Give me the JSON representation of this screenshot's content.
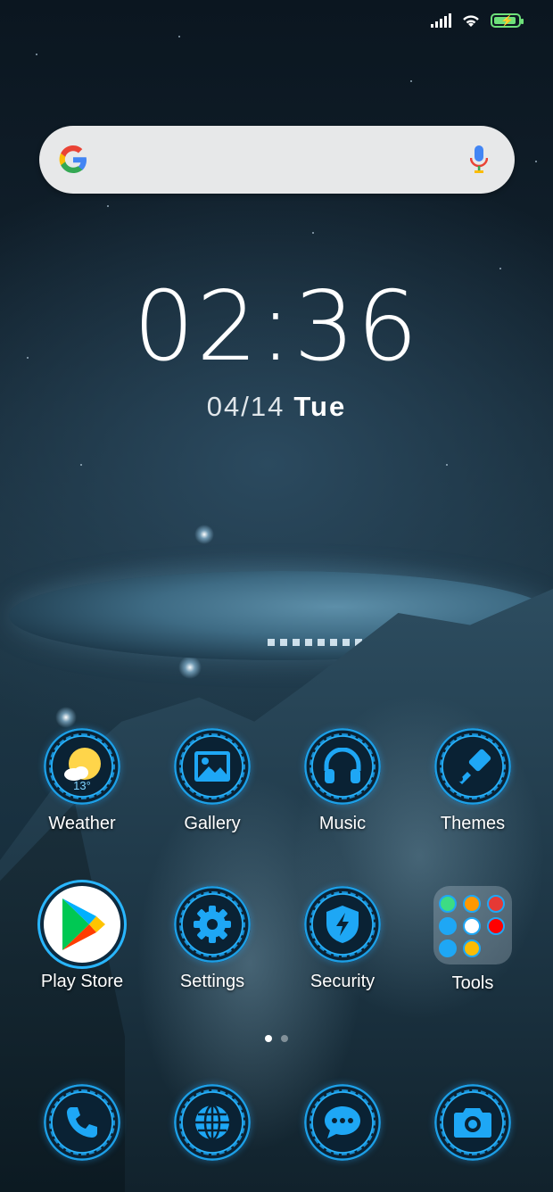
{
  "status_bar": {
    "signal": "signal-icon",
    "wifi": "wifi-icon",
    "battery": "battery-charging-icon",
    "battery_color": "#6ee07a"
  },
  "search": {
    "logo": "google-logo",
    "mic": "mic-icon"
  },
  "clock": {
    "time": "02:36",
    "date": "04/14",
    "day": "Tue"
  },
  "apps": [
    {
      "label": "Weather",
      "icon": "weather-icon",
      "temp": "13°"
    },
    {
      "label": "Gallery",
      "icon": "gallery-icon"
    },
    {
      "label": "Music",
      "icon": "headphones-icon"
    },
    {
      "label": "Themes",
      "icon": "brush-icon"
    },
    {
      "label": "Play Store",
      "icon": "play-store-icon"
    },
    {
      "label": "Settings",
      "icon": "gear-icon"
    },
    {
      "label": "Security",
      "icon": "shield-icon"
    },
    {
      "label": "Tools",
      "icon": "folder-icon"
    }
  ],
  "page_indicator": {
    "pages": 2,
    "active": 1
  },
  "dock": [
    {
      "icon": "phone-icon"
    },
    {
      "icon": "browser-icon"
    },
    {
      "icon": "messages-icon"
    },
    {
      "icon": "camera-icon"
    }
  ],
  "accent_color": "#29b6ff"
}
